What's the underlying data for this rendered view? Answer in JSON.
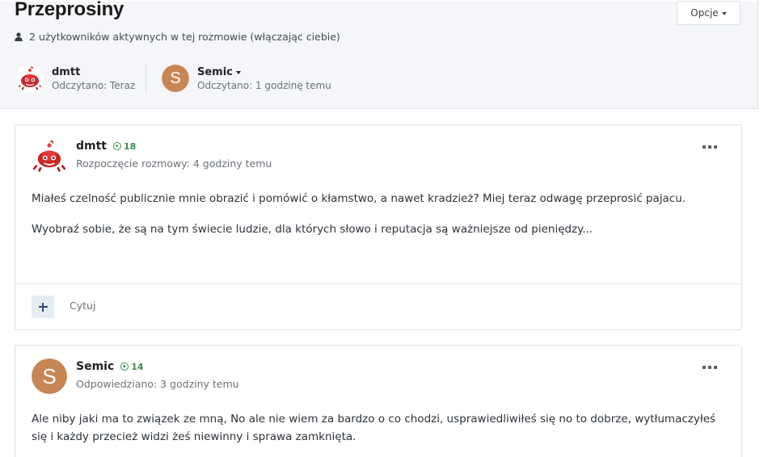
{
  "header": {
    "title": "Przeprosiny",
    "options_label": "Opcje",
    "active_users_text": "2 użytkowników aktywnych w tej rozmowie (włączając ciebie)"
  },
  "participants": [
    {
      "name": "dmtt",
      "status": "Odczytano: Teraz",
      "avatar": "red-crab-avatar"
    },
    {
      "name": "Semic",
      "status": "Odczytano: 1 godzinę temu",
      "avatar_letter": "S",
      "avatar_color": "#c88655"
    }
  ],
  "posts": [
    {
      "author": "dmtt",
      "reputation": "18",
      "meta": "Rozpoczęcie rozmowy: 4 godziny temu",
      "paragraphs": [
        "Miałeś czelność publicznie mnie obrazić i pomówić o kłamstwo, a nawet kradzież? Miej teraz odwagę przeprosić pajacu.",
        "Wyobraź sobie, że są na tym świecie ludzie, dla których słowo i reputacja są ważniejsze od pieniędzy..."
      ],
      "quote_label": "Cytuj"
    },
    {
      "author": "Semic",
      "reputation": "14",
      "meta": "Odpowiedziano: 3 godziny temu",
      "avatar_letter": "S",
      "paragraphs": [
        "Ale niby jaki ma to związek ze mną, No ale nie wiem za bardzo o co chodzi, usprawiedliwiłeś się no to dobrze, wytłumaczyłeś się i każdy przecież widzi żeś niewinny i sprawa zamknięta."
      ]
    }
  ],
  "colors": {
    "header_bg": "#f4f6f9",
    "reputation_green": "#3c8a4e",
    "semic_avatar": "#c88655",
    "plus_button_bg": "#e6ecf4"
  }
}
